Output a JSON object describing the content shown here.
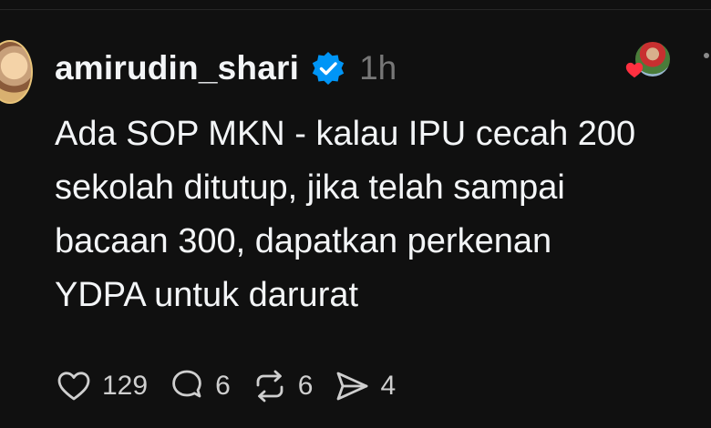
{
  "post": {
    "username": "amirudin_shari",
    "time": "1h",
    "lines": [
      "Ada SOP MKN - kalau IPU cecah 200",
      "sekolah ditutup, jika telah sampai",
      "bacaan 300, dapatkan perkenan",
      "YDPA untuk darurat"
    ]
  },
  "actions": {
    "likes": "129",
    "replies": "6",
    "reposts": "6",
    "shares": "4"
  },
  "icons": {
    "verified": "verified-badge-icon",
    "like": "heart-icon",
    "reply": "comment-icon",
    "repost": "repost-icon",
    "share": "send-icon",
    "liked": "red-heart-icon"
  },
  "colors": {
    "background": "#101010",
    "verified": "#0095f6",
    "liked_heart": "#ff3040",
    "muted": "#777777"
  }
}
